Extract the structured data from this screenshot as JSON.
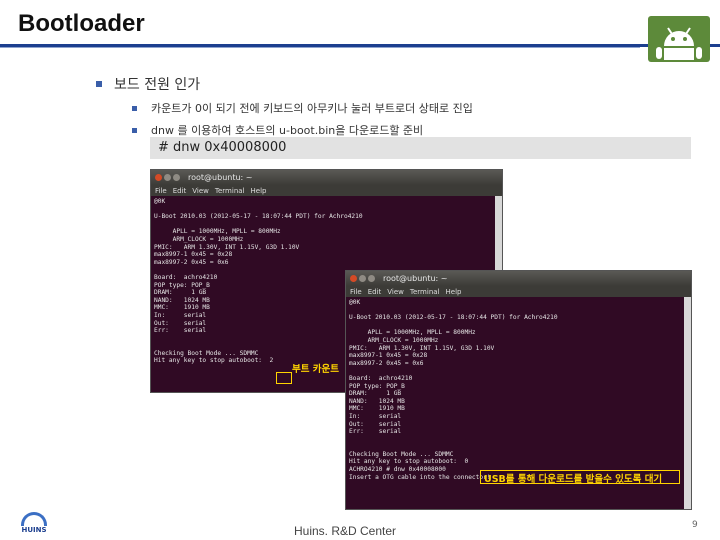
{
  "slide": {
    "title": "Bootloader",
    "page_number": "9",
    "footer": "Huins. R&D Center"
  },
  "logos": {
    "brand": "HUINS"
  },
  "bullets": {
    "level1": "보드 전원 인가",
    "level2": [
      "카운트가 0이 되기 전에 키보드의 아무키나 눌러 부트로더 상태로 진입",
      "dnw 를 이용하여 호스트의 u-boot.bin을 다운로드할 준비"
    ]
  },
  "command": "# dnw 0x40008000",
  "terminal1": {
    "title": "root@ubuntu: ~",
    "menu": [
      "File",
      "Edit",
      "View",
      "Terminal",
      "Help"
    ],
    "lines": "@0K\n\nU-Boot 2010.03 (2012-05-17 - 18:07:44 PDT) for Achro4210\n\n     APLL = 1000MHz, MPLL = 800MHz\n     ARM_CLOCK = 1000MHz\nPMIC:   ARM 1.30V, INT 1.15V, G3D 1.10V\nmax8997-1 0x45 = 0x28\nmax8997-2 0x45 = 0x6\n\nBoard:  achro4210\nPOP type: POP_B\nDRAM:     1 GB\nNAND:   1024 MB\nMMC:    1910 MB\nIn:     serial\nOut:    serial\nErr:    serial\n\n\nChecking Boot Mode ... SDMMC\nHit any key to stop autoboot:  2",
    "annotation": "부트 카운트"
  },
  "terminal2": {
    "title": "root@ubuntu: ~",
    "menu": [
      "File",
      "Edit",
      "View",
      "Terminal",
      "Help"
    ],
    "lines": "@0K\n\nU-Boot 2010.03 (2012-05-17 - 18:07:44 PDT) for Achro4210\n\n     APLL = 1000MHz, MPLL = 800MHz\n     ARM_CLOCK = 1000MHz\nPMIC:   ARM 1.30V, INT 1.15V, G3D 1.10V\nmax8997-1 0x45 = 0x28\nmax8997-2 0x45 = 0x6\n\nBoard:  achro4210\nPOP type: POP_B\nDRAM:     1 GB\nNAND:   1024 MB\nMMC:    1910 MB\nIn:     serial\nOut:    serial\nErr:    serial\n\n\nChecking Boot Mode ... SDMMC\nHit any key to stop autoboot:  0\nACHRO4210 # dnw 0x40008000\nInsert a OTG cable into the connector!",
    "annotation": "USB를 통해 다운로드를 받을수 있도록 대기"
  }
}
